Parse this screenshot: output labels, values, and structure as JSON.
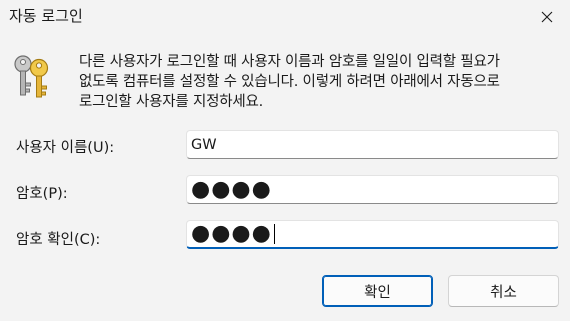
{
  "window": {
    "title": "자동 로그인",
    "close_icon": "close-icon"
  },
  "icon": {
    "name": "keys-icon",
    "colors": {
      "gold": "#e8c13a",
      "silver": "#a8a8a8"
    }
  },
  "description": {
    "line1": "다른 사용자가 로그인할 때 사용자 이름과 암호를 일일이 입력할 필요가",
    "line2": "없도록 컴퓨터를 설정할 수 있습니다. 이렇게 하려면 아래에서 자동으로",
    "line3": "로그인할 사용자를 지정하세요."
  },
  "fields": {
    "username": {
      "label": "사용자 이름(U):",
      "value": "GW"
    },
    "password": {
      "label": "암호(P):",
      "value": "●●●●"
    },
    "confirm": {
      "label": "암호 확인(C):",
      "value": "●●●●"
    }
  },
  "buttons": {
    "ok": "확인",
    "cancel": "취소"
  },
  "colors": {
    "accent": "#005fb8",
    "background": "#f3f3f3"
  }
}
